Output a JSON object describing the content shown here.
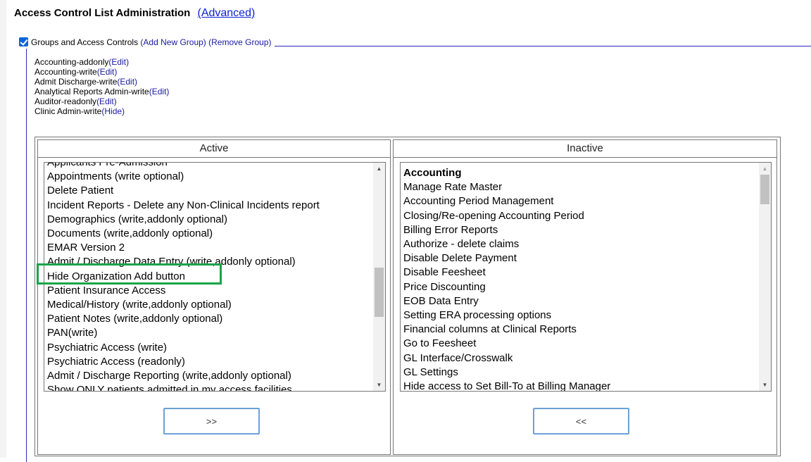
{
  "header": {
    "title": "Access Control List Administration",
    "advanced_link": "(Advanced)"
  },
  "groups_section": {
    "checkbox_checked": true,
    "label": "Groups and Access Controls",
    "add_link": "(Add New Group)",
    "remove_link": "(Remove Group)"
  },
  "groups": [
    {
      "name": "Accounting-addonly",
      "action": "(Edit)"
    },
    {
      "name": "Accounting-write",
      "action": "(Edit)"
    },
    {
      "name": "Admit Discharge-write",
      "action": "(Edit)"
    },
    {
      "name": "Analytical Reports Admin-write",
      "action": "(Edit)"
    },
    {
      "name": "Auditor-readonly",
      "action": "(Edit)"
    },
    {
      "name": "Clinic Admin-write",
      "action": "(Hide)"
    }
  ],
  "active": {
    "header": "Active",
    "items": [
      "Applicants Pre-Admission",
      "Appointments (write optional)",
      "Delete Patient",
      "Incident Reports - Delete any Non-Clinical Incidents report",
      "Demographics (write,addonly optional)",
      "Documents (write,addonly optional)",
      "EMAR Version 2",
      "Admit / Discharge Data Entry (write,addonly optional)",
      "Hide Organization Add button",
      "Patient Insurance Access",
      "Medical/History (write,addonly optional)",
      "Patient Notes (write,addonly optional)",
      "PAN(write)",
      "Psychiatric Access (write)",
      "Psychiatric Access (readonly)",
      "Admit / Discharge Reporting (write,addonly optional)",
      "Show ONLY patients admitted in my access facilities"
    ],
    "move_button": ">>",
    "scroll_fraction": 0.6
  },
  "inactive": {
    "header": "Inactive",
    "items": [
      "Accounting",
      "Manage Rate Master",
      "Accounting Period Management",
      "Closing/Re-opening Accounting Period",
      "Billing Error Reports",
      "Authorize - delete claims",
      "Disable Delete Payment",
      "Disable Feesheet",
      "Price Discounting",
      "EOB Data Entry",
      "Setting ERA processing options",
      "Financial columns at Clinical Reports",
      "Go to Feesheet",
      "GL Interface/Crosswalk",
      "GL Settings",
      "Hide access to Set Bill-To at Billing Manager"
    ],
    "bold_items": [
      "Accounting"
    ],
    "move_button": "<<",
    "scroll_fraction": 0.0
  },
  "highlighted_item": "Hide Organization Add button",
  "colors": {
    "link": "#1a1a9f",
    "highlight": "#19a44a",
    "checkbox": "#0a64d6"
  }
}
